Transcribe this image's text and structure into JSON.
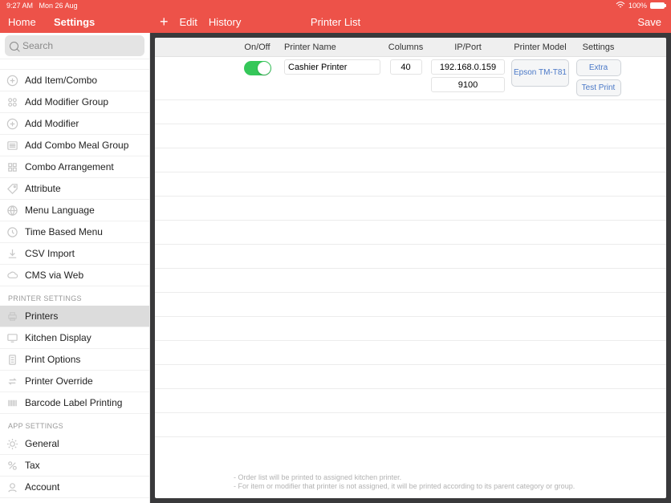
{
  "statusbar": {
    "time": "9:27 AM",
    "date": "Mon 26 Aug",
    "battery": "100%"
  },
  "topnav": {
    "home": "Home",
    "settings": "Settings",
    "edit": "Edit",
    "history": "History",
    "title": "Printer List",
    "save": "Save"
  },
  "search": {
    "placeholder": "Search"
  },
  "menu": {
    "items": [
      {
        "label": "Add Item/Combo",
        "icon": "plus"
      },
      {
        "label": "Add Modifier Group",
        "icon": "grid"
      },
      {
        "label": "Add Modifier",
        "icon": "plus"
      },
      {
        "label": "Add Combo Meal Group",
        "icon": "list"
      },
      {
        "label": "Combo Arrangement",
        "icon": "grid"
      },
      {
        "label": "Attribute",
        "icon": "tag"
      },
      {
        "label": "Menu Language",
        "icon": "globe"
      },
      {
        "label": "Time Based Menu",
        "icon": "clock"
      },
      {
        "label": "CSV Import",
        "icon": "download"
      },
      {
        "label": "CMS via Web",
        "icon": "cloud"
      }
    ],
    "section_printer": "PRINTER SETTINGS",
    "printer_items": [
      {
        "label": "Printers",
        "icon": "printer",
        "active": true
      },
      {
        "label": "Kitchen Display",
        "icon": "display"
      },
      {
        "label": "Print Options",
        "icon": "doc"
      },
      {
        "label": "Printer Override",
        "icon": "swap"
      },
      {
        "label": "Barcode Label Printing",
        "icon": "barcode"
      }
    ],
    "section_app": "APP SETTINGS",
    "app_items": [
      {
        "label": "General",
        "icon": "gear"
      },
      {
        "label": "Tax",
        "icon": "percent"
      },
      {
        "label": "Account",
        "icon": "user"
      }
    ]
  },
  "table": {
    "headers": {
      "onoff": "On/Off",
      "name": "Printer Name",
      "cols": "Columns",
      "ip": "IP/Port",
      "model": "Printer Model",
      "settings": "Settings"
    },
    "row": {
      "on": true,
      "name": "Cashier Printer",
      "columns": "40",
      "ip": "192.168.0.159",
      "port": "9100",
      "model": "Epson TM-T81",
      "extra": "Extra",
      "test": "Test Print"
    }
  },
  "footer": {
    "line1": "Order list will be printed to assigned kitchen printer.",
    "line2": "For item or modifier that printer is not assigned, it will be printed according to its parent category or group."
  }
}
